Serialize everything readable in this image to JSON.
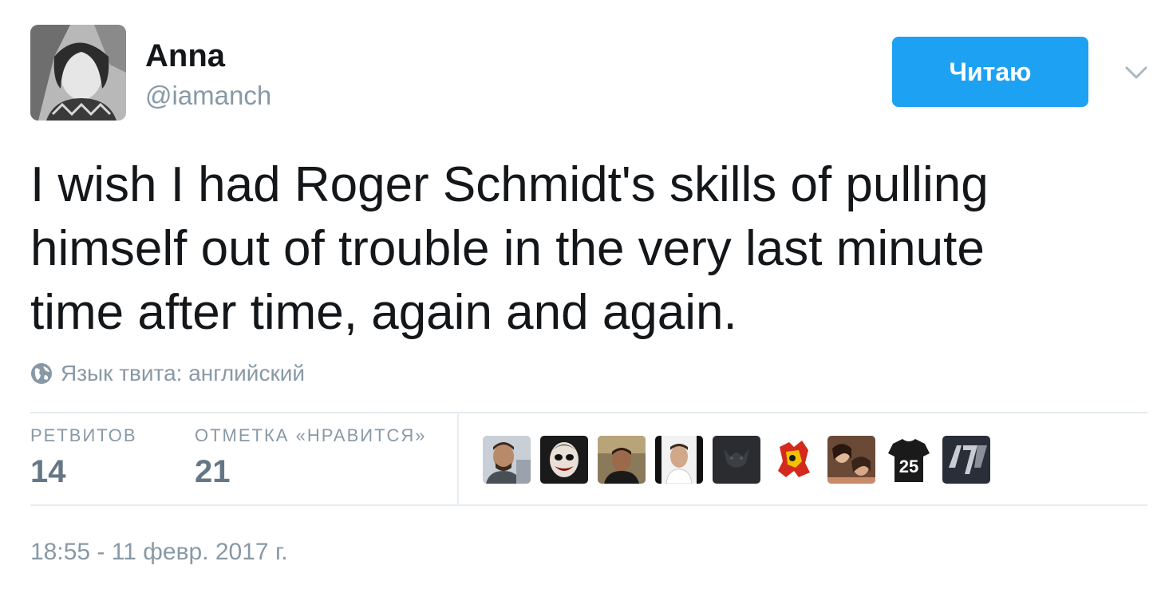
{
  "user": {
    "name": "Anna",
    "handle": "@iamanch"
  },
  "follow_button": {
    "label": "Читаю"
  },
  "tweet": {
    "text": "I wish I had Roger Schmidt's skills of pulling himself out of trouble in the very last minute time after time, again and again.",
    "language_label": "Язык твита: английский",
    "timestamp": "18:55 - 11 февр. 2017 г."
  },
  "stats": {
    "retweets_label": "РЕТВИТОВ",
    "retweets_count": "14",
    "likes_label": "ОТМЕТКА «НРАВИТСЯ»",
    "likes_count": "21"
  },
  "liker_badge_number": "25",
  "colors": {
    "accent": "#1da1f2",
    "muted_text": "#8899a6",
    "border": "#e6ecf0"
  }
}
